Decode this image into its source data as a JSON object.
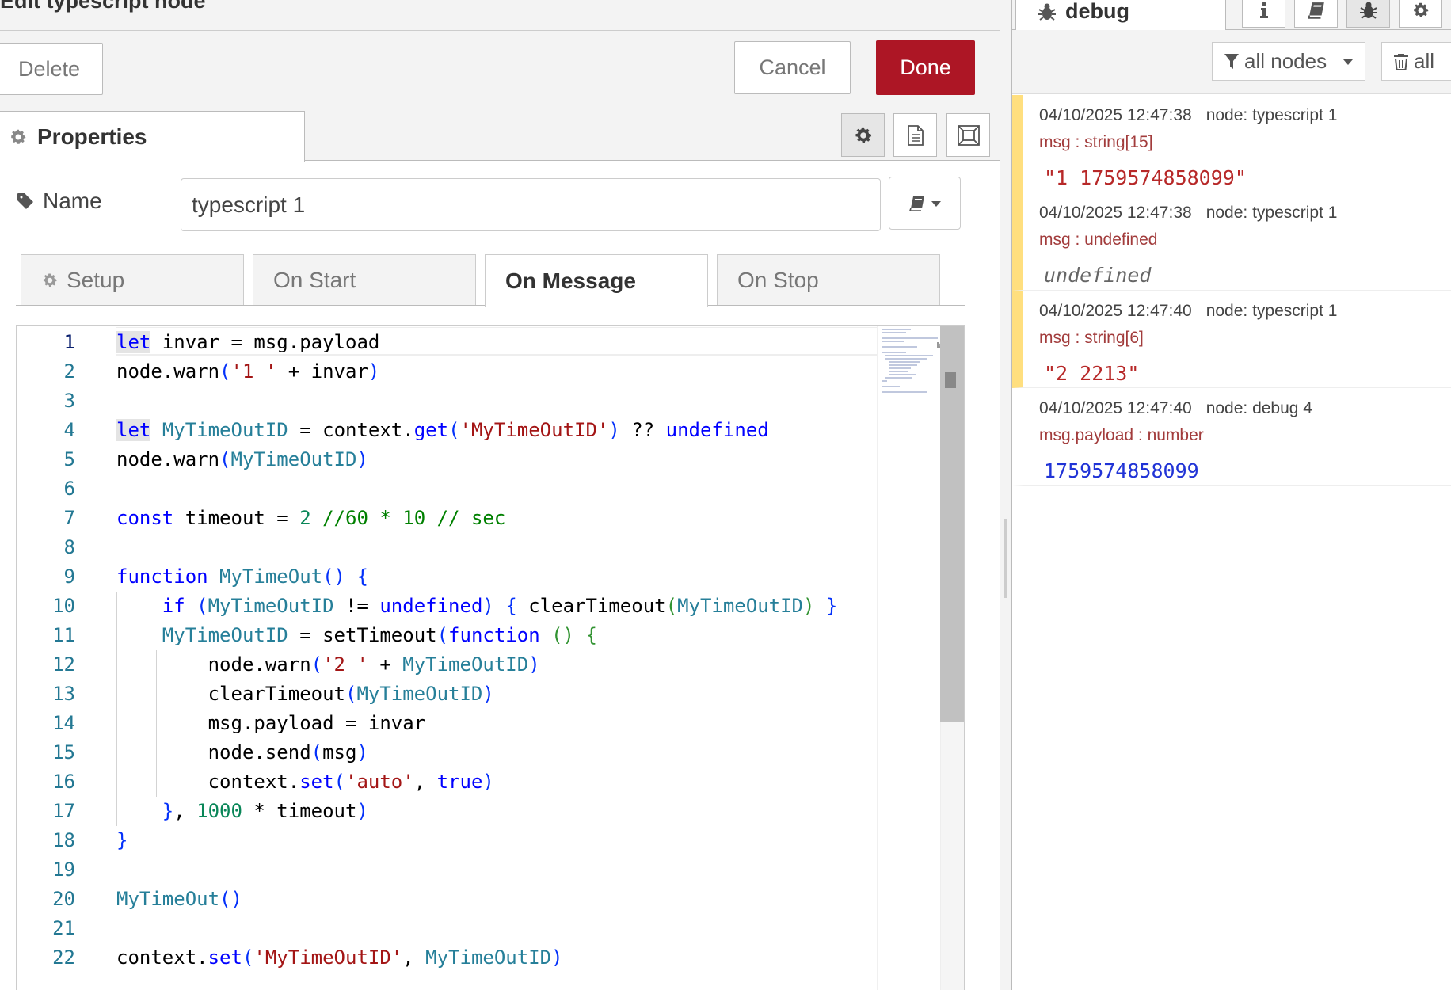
{
  "editor": {
    "title": "Edit typescript node",
    "buttons": {
      "delete": "Delete",
      "cancel": "Cancel",
      "done": "Done"
    },
    "properties_tab": "Properties",
    "name_label": "Name",
    "name_value": "typescript 1",
    "subtabs": [
      "Setup",
      "On Start",
      "On Message",
      "On Stop"
    ],
    "active_subtab": "On Message",
    "code": {
      "current_line": 1,
      "line_numbers": [
        "1",
        "2",
        "3",
        "4",
        "5",
        "6",
        "7",
        "8",
        "9",
        "10",
        "11",
        "12",
        "13",
        "14",
        "15",
        "16",
        "17",
        "18",
        "19",
        "20",
        "21",
        "22"
      ],
      "lines": [
        "let invar = msg.payload",
        "node.warn('1 ' + invar)",
        "",
        "let MyTimeOutID = context.get('MyTimeOutID') ?? undefined",
        "node.warn(MyTimeOutID)",
        "",
        "const timeout = 2 //60 * 10 // sec",
        "",
        "function MyTimeOut() {",
        "    if (MyTimeOutID != undefined) { clearTimeout(MyTimeOutID) }",
        "    MyTimeOutID = setTimeout(function () {",
        "        node.warn('2 ' + MyTimeOutID)",
        "        clearTimeout(MyTimeOutID)",
        "        msg.payload = invar",
        "        node.send(msg)",
        "        context.set('auto', true)",
        "    }, 1000 * timeout)",
        "}",
        "",
        "MyTimeOut()",
        "",
        "context.set('MyTimeOutID', MyTimeOutID)"
      ]
    }
  },
  "sidebar": {
    "tab_label": "debug",
    "filter_label": "all nodes",
    "clear_label": "all",
    "messages": [
      {
        "timestamp": "04/10/2025 12:47:38",
        "node": "node: typescript 1",
        "type": "msg : string[15]",
        "value": "\"1 1759574858099\"",
        "kind": "string",
        "level": "warn"
      },
      {
        "timestamp": "04/10/2025 12:47:38",
        "node": "node: typescript 1",
        "type": "msg : undefined",
        "value": "undefined",
        "kind": "undefined",
        "level": "warn"
      },
      {
        "timestamp": "04/10/2025 12:47:40",
        "node": "node: typescript 1",
        "type": "msg : string[6]",
        "value": "\"2 2213\"",
        "kind": "string",
        "level": "warn"
      },
      {
        "timestamp": "04/10/2025 12:47:40",
        "node": "node: debug 4",
        "type": "msg.payload : number",
        "value": "1759574858099",
        "kind": "number",
        "level": "normal"
      }
    ]
  },
  "colors": {
    "done_button": "#ad1625",
    "warn_bar": "#ffdf7f",
    "string_value": "#b72828",
    "number_value": "#2033d6",
    "type_label": "#a23c3c",
    "keyword": "#0000ff",
    "identifier": "#267f99",
    "string_literal": "#a31515",
    "numeric_literal": "#098658",
    "comment": "#008000"
  },
  "icons": {
    "properties": "gear-icon",
    "name": "tag-icon",
    "library": "book-icon",
    "setup": "gear-icon",
    "debug": "bug-icon",
    "filter": "filter-icon",
    "clear": "trash-icon"
  }
}
